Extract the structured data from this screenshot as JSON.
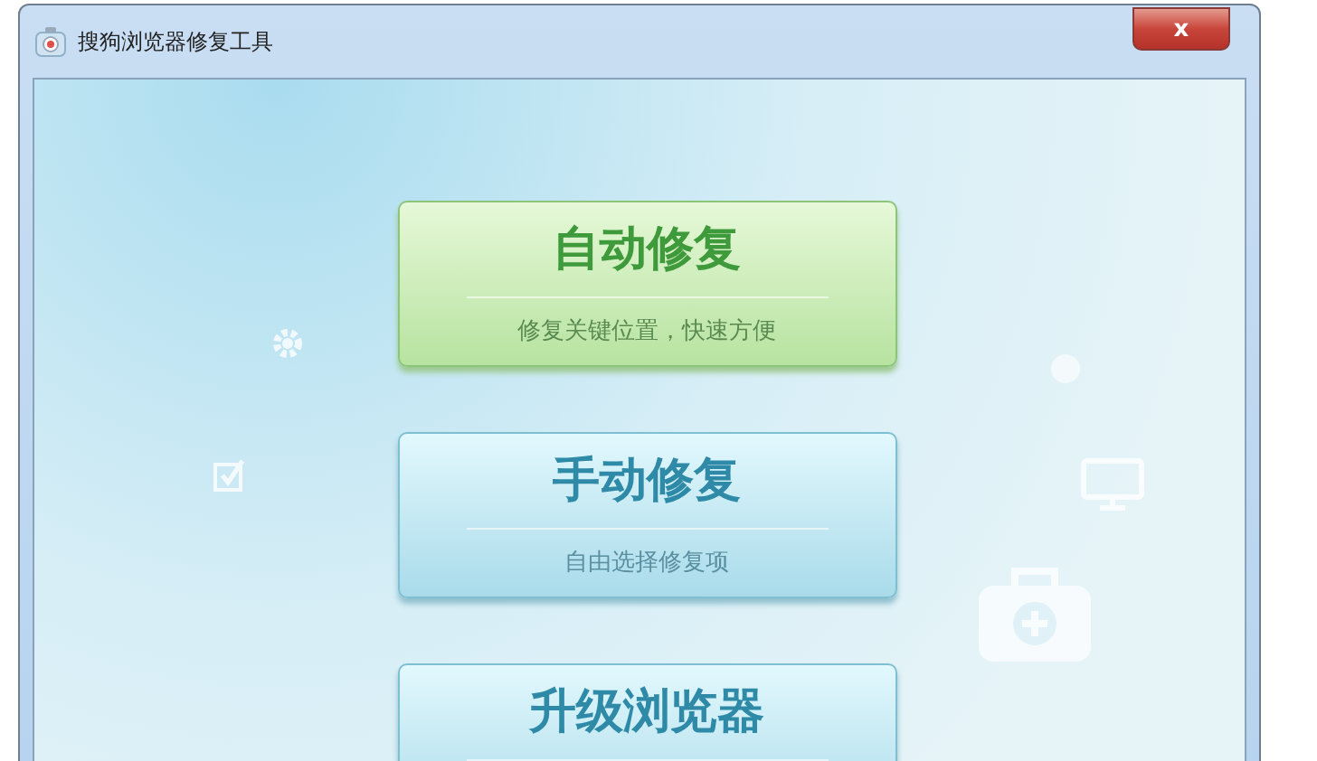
{
  "window": {
    "title": "搜狗浏览器修复工具",
    "close": "x"
  },
  "actions": [
    {
      "kind": "green",
      "title": "自动修复",
      "subtitle": "修复关键位置，快速方便"
    },
    {
      "kind": "blue",
      "title": "手动修复",
      "subtitle": "自由选择修复项"
    },
    {
      "kind": "blue",
      "title": "升级浏览器"
    }
  ]
}
